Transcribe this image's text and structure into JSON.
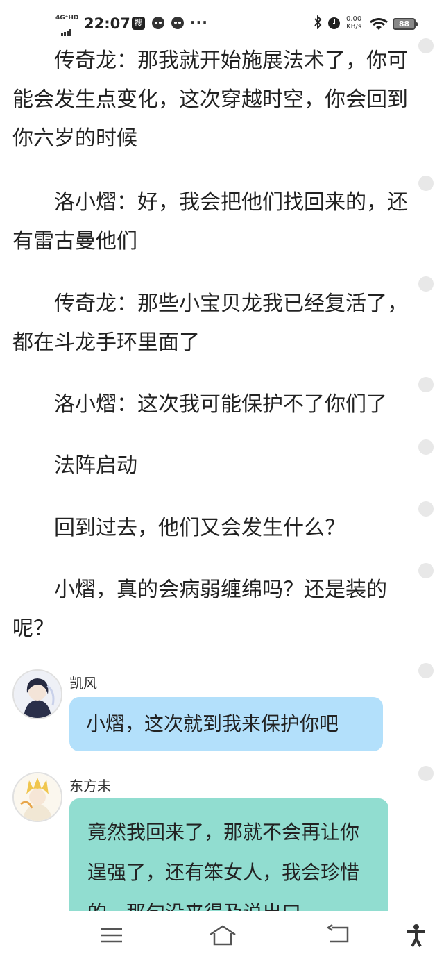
{
  "status_bar": {
    "network": "4G⁺HD",
    "time": "22:07",
    "search_glyph": "搜",
    "more": "···",
    "net_speed_value": "0.00",
    "net_speed_unit": "KB/s",
    "battery": "88",
    "icons": [
      "signal-icon",
      "search-app-icon",
      "face-app-icon",
      "face-app-icon",
      "bluetooth-icon",
      "alarm-icon",
      "wifi-icon",
      "battery-icon"
    ]
  },
  "story": [
    "传奇龙：那我就开始施展法术了，你可能会发生点变化，这次穿越时空，你会回到你六岁的时候",
    "洛小熠：好，我会把他们找回来的，还有雷古曼他们",
    "传奇龙：那些小宝贝龙我已经复活了，都在斗龙手环里面了",
    "洛小熠：这次我可能保护不了你们了",
    "法阵启动",
    "回到过去，他们又会发生什么？",
    "小熠，真的会病弱缠绵吗？还是装的呢？"
  ],
  "chat": [
    {
      "speaker": "凯风",
      "text": "小熠，这次就到我来保护你吧",
      "bubble_color": "#b3e0fb"
    },
    {
      "speaker": "东方未",
      "text": "竟然我回来了，那就不会再让你逞强了，还有笨女人，我会珍惜的，那句没来得及说出口",
      "bubble_color": "#91ddd0"
    }
  ],
  "navbar": {
    "icons": [
      "menu-icon",
      "home-icon",
      "back-icon",
      "accessibility-icon"
    ]
  }
}
